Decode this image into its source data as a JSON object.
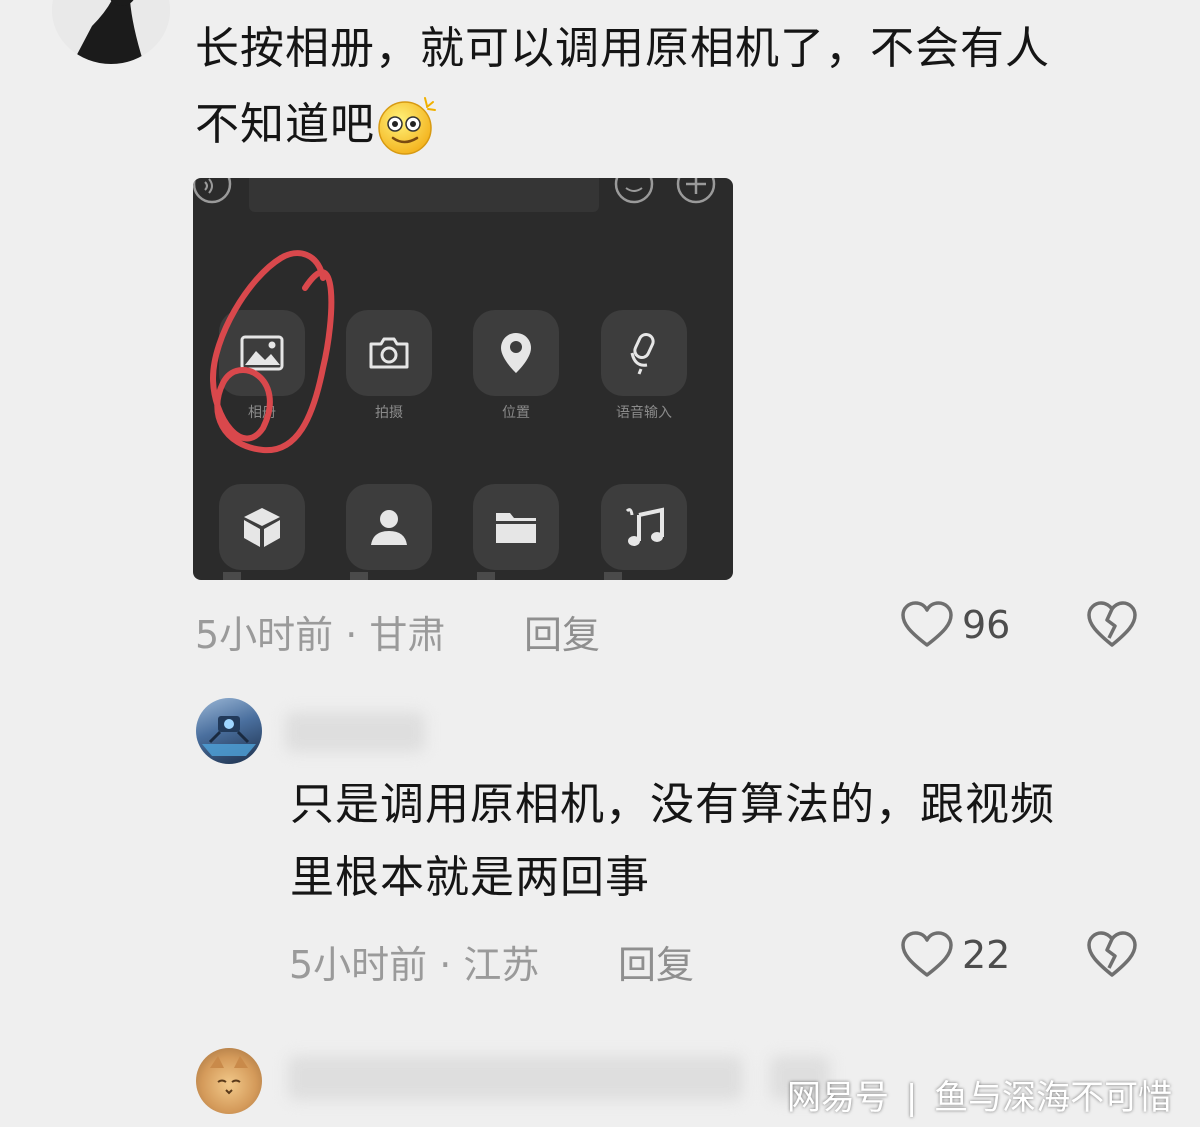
{
  "comments": [
    {
      "text_line1": "长按相册，就可以调用原相机了，不会有人",
      "text_line2": "不知道吧",
      "emoji_icon": "dizzy-smile-emoji",
      "meta": "5小时前 · 甘肃",
      "reply_label": "回复",
      "like_count": "96",
      "like_icon": "heart-outline-icon",
      "dislike_icon": "broken-heart-icon"
    },
    {
      "text_line1": "只是调用原相机，没有算法的，跟视频",
      "text_line2": "里根本就是两回事",
      "meta": "5小时前 · 江苏",
      "reply_label": "回复",
      "like_count": "22",
      "like_icon": "heart-outline-icon",
      "dislike_icon": "broken-heart-icon"
    }
  ],
  "screenshot": {
    "tiles": [
      {
        "icon": "photo-album-icon",
        "label": "相册"
      },
      {
        "icon": "camera-icon",
        "label": "拍摄"
      },
      {
        "icon": "location-icon",
        "label": "位置"
      },
      {
        "icon": "microphone-icon",
        "label": "语音输入"
      },
      {
        "icon": "cube-icon",
        "label": ""
      },
      {
        "icon": "person-icon",
        "label": ""
      },
      {
        "icon": "folder-icon",
        "label": ""
      },
      {
        "icon": "music-icon",
        "label": ""
      }
    ],
    "annotation_color": "#d9484c"
  },
  "watermark": {
    "brand": "网易号",
    "separator": "|",
    "author": "鱼与深海不可惜"
  },
  "colors": {
    "background": "#efefef",
    "meta_text": "#9a9a9a",
    "panel": "#2b2b2b"
  }
}
